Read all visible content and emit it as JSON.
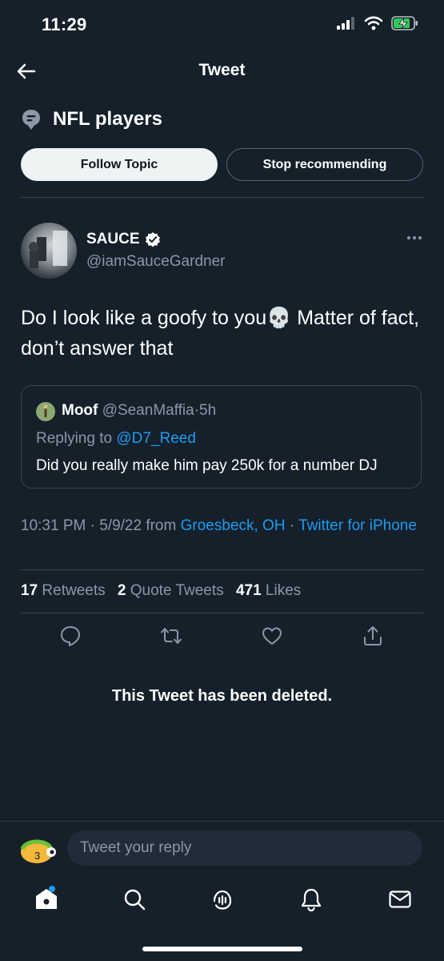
{
  "status_bar": {
    "time": "11:29"
  },
  "nav": {
    "title": "Tweet"
  },
  "topic": {
    "name": "NFL players",
    "follow_label": "Follow Topic",
    "stop_label": "Stop recommending"
  },
  "tweet": {
    "author_name": "SAUCE",
    "author_handle": "@iamSauceGardner",
    "text_part1": "Do I look like a goofy to you",
    "emoji": "💀",
    "text_part2": " Matter of fact, don’t answer that",
    "quote": {
      "name": "Moof",
      "handle": "@SeanMaffia",
      "separator": "·",
      "age": "5h",
      "replying_prefix": "Replying to ",
      "replying_to": "@D7_Reed",
      "text": "Did you really make him pay 250k for a number DJ"
    },
    "meta": {
      "time": "10:31 PM",
      "sep1": " · ",
      "date": "5/9/22",
      "from": " from ",
      "location": "Groesbeck, OH",
      "sep2": " · ",
      "client": "Twitter for iPhone"
    },
    "stats": {
      "retweets_count": "17",
      "retweets_label": "Retweets",
      "quotes_count": "2",
      "quotes_label": "Quote Tweets",
      "likes_count": "471",
      "likes_label": "Likes"
    },
    "deleted_notice": "This Tweet has been deleted."
  },
  "reply": {
    "placeholder": "Tweet your reply"
  },
  "icons": {
    "back": "arrow-left-icon",
    "topic": "topic-icon",
    "verified": "verified-badge-icon",
    "more": "more-dots-icon",
    "reply": "comment-icon",
    "retweet": "retweet-icon",
    "like": "heart-icon",
    "share": "share-icon",
    "home": "home-icon",
    "search": "search-icon",
    "spaces": "spaces-icon",
    "notifications": "bell-icon",
    "messages": "mail-icon"
  },
  "colors": {
    "background": "#15202b",
    "accent": "#1d9bf0",
    "secondary_text": "#8b98a5",
    "border": "#38444d"
  }
}
